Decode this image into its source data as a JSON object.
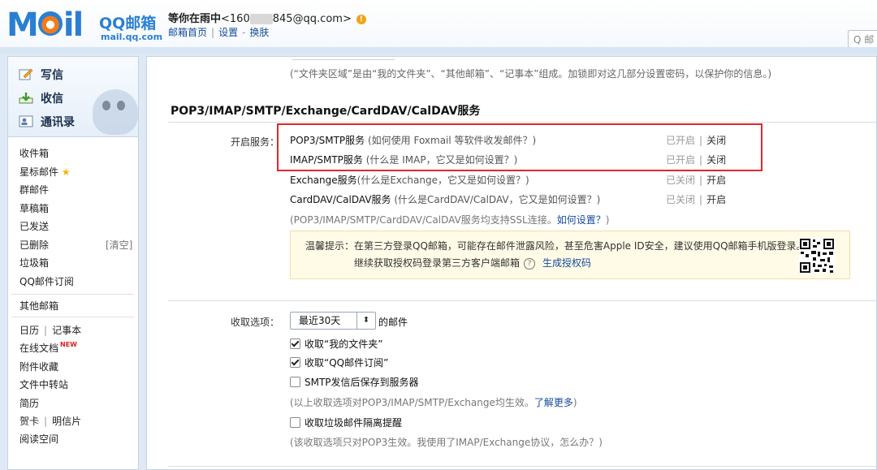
{
  "colors": {
    "brand": "#2a7fd5",
    "link": "#164a9c",
    "highlight_box": "#e0282e",
    "tip_bg": "#fffbe6"
  },
  "header": {
    "logo_text": "MOil",
    "logo_cn": "QQ邮箱",
    "logo_domain": "mail.qq.com",
    "nickname": "等你在雨中",
    "email_prefix": "<160",
    "email_suffix": "845@qq.com>",
    "warn_icon": "!",
    "links": {
      "home": "邮箱首页",
      "settings": "设置",
      "skin": "换肤"
    },
    "search_placeholder": "Q 邮"
  },
  "sidebar": {
    "quick": {
      "write": "写信",
      "receive": "收信",
      "contacts": "通讯录"
    },
    "folders": {
      "inbox": "收件箱",
      "starred": "星标邮件",
      "group": "群邮件",
      "drafts": "草稿箱",
      "sent": "已发送",
      "deleted": "已删除",
      "clear": "[清空]",
      "spam": "垃圾箱",
      "subscriptions": "QQ邮件订阅",
      "other": "其他邮箱",
      "calendar": "日历",
      "notebook": "记事本",
      "docs": "在线文档",
      "new_badge": "NEW",
      "attachments": "附件收藏",
      "transfer": "文件中转站",
      "resume": "简历",
      "cards": "贺卡",
      "postcards": "明信片",
      "reading": "阅读空间"
    }
  },
  "main": {
    "top_note": "(“文件夹区域”是由“我的文件夹”、“其他邮箱”、“记事本”组成。加锁即对这几部分设置密码，以保护你的信息。)",
    "section_title": "POP3/IMAP/SMTP/Exchange/CardDAV/CalDAV服务",
    "service_label": "开启服务：",
    "services": [
      {
        "name": "POP3/SMTP服务",
        "hint": "(如何使用 Foxmail 等软件收发邮件？)",
        "status": "已开启",
        "action": "关闭"
      },
      {
        "name": "IMAP/SMTP服务",
        "hint": "(什么是 IMAP，它又是如何设置？)",
        "status": "已开启",
        "action": "关闭"
      },
      {
        "name": "Exchange服务",
        "hint": "(什么是Exchange，它又是如何设置？)",
        "status": "已关闭",
        "action": "开启"
      },
      {
        "name": "CardDAV/CalDAV服务",
        "hint": "(什么是CardDAV/CalDAV，它又是如何设置？)",
        "status": "已关闭",
        "action": "开启"
      }
    ],
    "ssl_note": "(POP3/IMAP/SMTP/CardDAV/CalDAV服务均支持SSL连接。",
    "ssl_link": "如何设置？",
    "ssl_end": ")",
    "tip_line1": "温馨提示：在第三方登录QQ邮箱，可能存在邮件泄露风险，甚至危害Apple ID安全，建议使用QQ邮箱手机版登录。",
    "tip_line2": "继续获取授权码登录第三方客户端邮箱",
    "tip_qmark": "?",
    "tip_link": "生成授权码",
    "receive_label": "收取选项：",
    "receive_select": "最近30天",
    "receive_select_arrow": "⬍",
    "receive_suffix": "的邮件",
    "opt_myfolders": "收取“我的文件夹”",
    "opt_subscriptions": "收取“QQ邮件订阅”",
    "opt_smtp_save": "SMTP发信后保存到服务器",
    "opt_note1": "(以上收取选项对POP3/IMAP/SMTP/Exchange均生效。",
    "opt_note1_link": "了解更多",
    "opt_note1_end": ")",
    "opt_spam": "收取垃圾邮件隔离提醒",
    "opt_note2": "(该收取选项只对POP3生效。我使用了IMAP/Exchange协议，怎么办？)",
    "checkboxes": {
      "myfolders": true,
      "subscriptions": true,
      "smtp_save": false,
      "spam": false
    }
  }
}
